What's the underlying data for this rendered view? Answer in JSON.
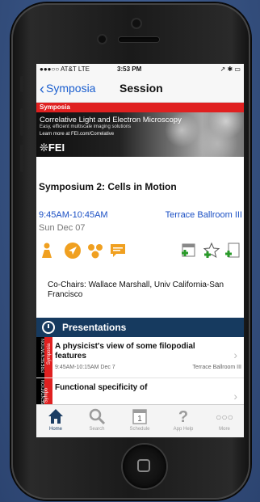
{
  "status": {
    "carrier": "●●●○○ AT&T  LTE",
    "time": "3:53 PM",
    "right": "↗ ✱ ▭"
  },
  "nav": {
    "back_label": "Symposia",
    "title": "Session"
  },
  "banner": {
    "strip": "Symposia",
    "title": "Correlative Light and Electron Microscopy",
    "subtitle": "Easy, efficient multiscale imaging solutions",
    "learn": "Learn more at FEI.com/Correlative",
    "logo": "FEI"
  },
  "session": {
    "title": "Symposium 2: Cells in Motion",
    "time": "9:45AM-10:45AM",
    "room": "Terrace Ballroom III",
    "date": "Sun Dec 07",
    "chairs": "Co-Chairs: Wallace Marshall, Univ California-San Francisco"
  },
  "section": {
    "label": "Presentations"
  },
  "presentations": [
    {
      "tag1": "PRESENTATION",
      "tag2": "Symposia",
      "title": "A physicist's view of some filopodial features",
      "meta": "9:45AM-10:15AM  Dec 7",
      "room": "Terrace Ballroom III"
    },
    {
      "tag1": "PRESENTATION",
      "tag2": "Sympo",
      "title": "Functional specificity of",
      "meta": "",
      "room": ""
    }
  ],
  "tabs": [
    {
      "label": "Home",
      "icon": "home-icon"
    },
    {
      "label": "Search",
      "icon": "search-icon"
    },
    {
      "label": "Schedule",
      "icon": "calendar-icon"
    },
    {
      "label": "App Help",
      "icon": "help-icon"
    },
    {
      "label": "More",
      "icon": "more-icon"
    }
  ],
  "schedule_day": "1",
  "colors": {
    "accent": "#1a4fc4",
    "banner_red": "#e02020",
    "section": "#163a5f",
    "icon_orange": "#f0a020",
    "icon_green": "#2a9a2a"
  }
}
